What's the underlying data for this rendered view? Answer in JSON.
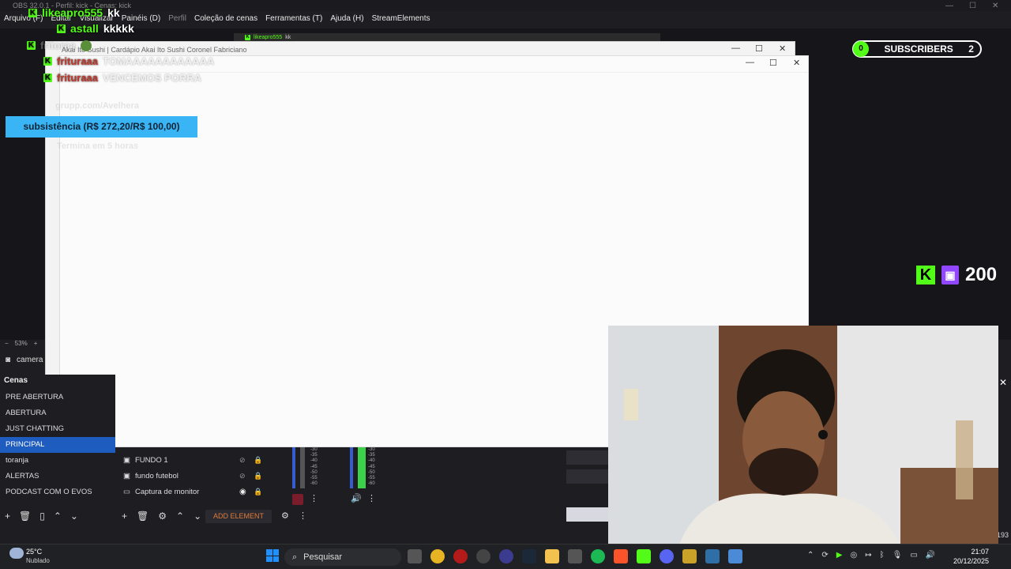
{
  "obs": {
    "title": "OBS 32.0.1 - Perfil: kick - Cenas: kick",
    "menu": [
      "Arquivo (F)",
      "Editar",
      "Visualizar",
      "Painéis (D)",
      "Perfil",
      "Coleção de cenas",
      "Ferramentas (T)",
      "Ajuda (H)",
      "StreamElements"
    ],
    "zoom": "53%",
    "camera_label": "camera"
  },
  "chat": [
    {
      "user": "likeapro555",
      "msg": "kk",
      "color": "green"
    },
    {
      "user": "astall",
      "msg": "kkkkk",
      "color": "green"
    },
    {
      "user": "fritoraa",
      "msg": "",
      "color": "ghost"
    },
    {
      "user": "frituraaa",
      "msg": "TOMAAAAAAAAAAAA",
      "color": "red"
    },
    {
      "user": "frituraaa",
      "msg": "VENCEMOS PORRA",
      "color": "red"
    }
  ],
  "ghost_texts": {
    "line1": "grupp.com/Avelhera",
    "line2": "Termina em 5 horas"
  },
  "browser_back": {
    "title": "Akai Ito Sushi | Cardápio Akai Ito Sushi Coronel Fabriciano"
  },
  "browser_front": {
    "title": ""
  },
  "mini_header": {
    "user": "likeapro555",
    "msg": "kk"
  },
  "goal": {
    "text": "subsistência (R$ 272,20/R$ 100,00)"
  },
  "subscribers": {
    "count_left": "0",
    "label": "SUBSCRIBERS",
    "count_right": "2"
  },
  "followers": {
    "count": "200"
  },
  "scenes": {
    "header": "Cenas",
    "items": [
      "PRE ABERTURA",
      "ABERTURA",
      "JUST CHATTING",
      "PRINCIPAL",
      "toranja",
      "ALERTAS",
      "PODCAST COM O EVOS"
    ],
    "selected_index": 3
  },
  "sources": {
    "items": [
      "FUNDO 1",
      "fundo futebol",
      "Captura de monitor"
    ],
    "add_label": "ADD ELEMENT"
  },
  "meter_labels": [
    "-30",
    "-35",
    "-40",
    "-45",
    "-50",
    "-55",
    "-60"
  ],
  "taskbar": {
    "weather_temp": "25°C",
    "weather_desc": "Nublado",
    "search_placeholder": "Pesquisar",
    "time": "21:07",
    "date": "20/12/2025",
    "side_number": "193"
  },
  "colors": {
    "kick_green": "#53fc18",
    "twitch_purple": "#9146ff",
    "goal_blue": "#39b5f5",
    "scene_selected": "#1f5cbf"
  }
}
